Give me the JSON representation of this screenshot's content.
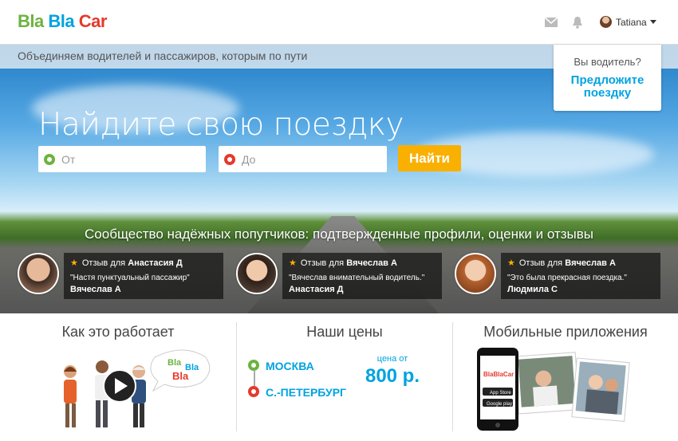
{
  "header": {
    "logo": {
      "part1": "Bla",
      "part2": "Bla",
      "part3": "Car"
    },
    "icons": [
      "mail-icon",
      "bell-icon"
    ],
    "user_name": "Tatiana"
  },
  "hero": {
    "tagline": "Объединяем водителей и пассажиров, которым по пути",
    "headline": "Найдите свою поездку",
    "from_placeholder": "От",
    "to_placeholder": "До",
    "find_button": "Найти",
    "community_text": "Сообщество надёжных попутчиков: подтвержденные профили, оценки и отзывы"
  },
  "driver_box": {
    "question": "Вы водитель?",
    "link_line1": "Предложите",
    "link_line2": "поездку"
  },
  "reviews": [
    {
      "prefix": "Отзыв для",
      "name": "Анастасия Д",
      "quote": "\"Настя пунктуальный пассажир\"",
      "author": "Вячеслав А"
    },
    {
      "prefix": "Отзыв для",
      "name": "Вячеслав А",
      "quote": "\"Вячеслав внимательный водитель.\"",
      "author": "Анастасия Д"
    },
    {
      "prefix": "Отзыв для",
      "name": "Вячеслав А",
      "quote": "\"Это была прекрасная поездка.\"",
      "author": "Людмила С"
    }
  ],
  "sections": {
    "how_it_works": "Как это работает",
    "prices": {
      "title": "Наши цены",
      "from_city": "МОСКВА",
      "to_city": "С.-ПЕТЕРБУРГ",
      "price_label": "цена от",
      "price": "800 р."
    },
    "mobile_apps": "Мобильные приложения",
    "bubble": {
      "line1": "Bla",
      "line2": "Bla",
      "line3": "Bla"
    },
    "phone_logo": "BlaBlaCar",
    "app_store": "App Store",
    "google_play": "Google play"
  },
  "colors": {
    "green": "#6cb33f",
    "blue": "#00a3e0",
    "red": "#e5392c",
    "orange": "#f9b000"
  }
}
